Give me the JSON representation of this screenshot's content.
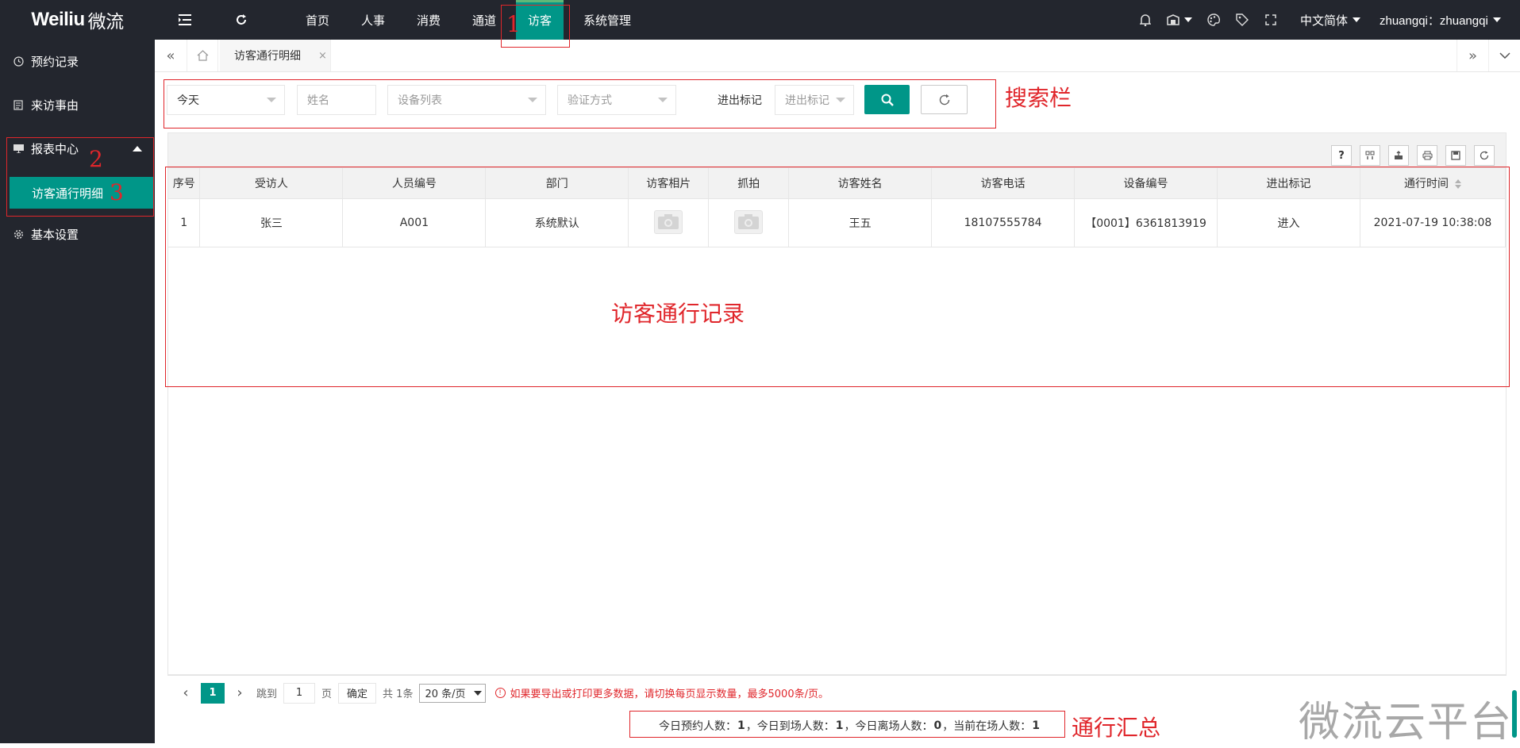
{
  "brand": {
    "logo_en": "Weiliu",
    "logo_cn": "微流"
  },
  "topnav": {
    "items": [
      "首页",
      "人事",
      "消费",
      "通道",
      "访客",
      "系统管理"
    ],
    "active": "访客",
    "lang": "中文简体",
    "user": "zhuangqi：zhuangqi",
    "icons": [
      "menu-fold-icon",
      "refresh-icon",
      "bell-icon",
      "theme-icon",
      "palette-icon",
      "tag-icon",
      "fullscreen-icon"
    ]
  },
  "sidebar": {
    "items": [
      {
        "label": "预约记录",
        "icon": "clock-icon"
      },
      {
        "label": "来访事由",
        "icon": "doc-icon"
      },
      {
        "label": "报表中心",
        "icon": "report-icon",
        "expanded": true
      },
      {
        "label": "基本设置",
        "icon": "gear-icon"
      }
    ],
    "active_sub": "访客通行明细"
  },
  "tabs": {
    "current": "访客通行明细",
    "close": "×"
  },
  "search": {
    "date_value": "今天",
    "name_placeholder": "姓名",
    "device_placeholder": "设备列表",
    "verify_placeholder": "验证方式",
    "io_label": "进出标记",
    "io_placeholder": "进出标记"
  },
  "table": {
    "columns": [
      "序号",
      "受访人",
      "人员编号",
      "部门",
      "访客相片",
      "抓拍",
      "访客姓名",
      "访客电话",
      "设备编号",
      "进出标记",
      "通行时间"
    ],
    "rows": [
      {
        "index": "1",
        "host": "张三",
        "emp_no": "A001",
        "dept": "系统默认",
        "photo": "NO IMAGE",
        "snapshot": "NO IMAGE",
        "visitor": "王五",
        "phone": "18107555784",
        "device": "【0001】6361813919",
        "io": "进入",
        "time": "2021-07-19 10:38:08"
      }
    ],
    "toolbar_icons": [
      "help-icon",
      "columns-icon",
      "export-icon",
      "print-icon",
      "save-icon",
      "refresh-icon"
    ]
  },
  "pager": {
    "current_page": "1",
    "goto_label": "跳到",
    "goto_value": "1",
    "page_label": "页",
    "confirm": "确定",
    "total": "共 1条",
    "per_page": "20 条/页",
    "tip": "如果要导出或打印更多数据，请切换每页显示数量，最多5000条/页。"
  },
  "summary": {
    "label1": "今日预约人数：",
    "val1": "1",
    "label2": "，今日到场人数：",
    "val2": "1",
    "label3": "，今日离场人数：",
    "val3": "0",
    "label4": "，当前在场人数：",
    "val4": "1"
  },
  "annotations": {
    "n1": "1",
    "n2": "2",
    "n3": "3",
    "search": "搜索栏",
    "records": "访客通行记录",
    "summary": "通行汇总",
    "watermark": "微流云平台"
  },
  "colors": {
    "accent": "#009688",
    "dark": "#23262e",
    "annotation": "#e0262b"
  }
}
